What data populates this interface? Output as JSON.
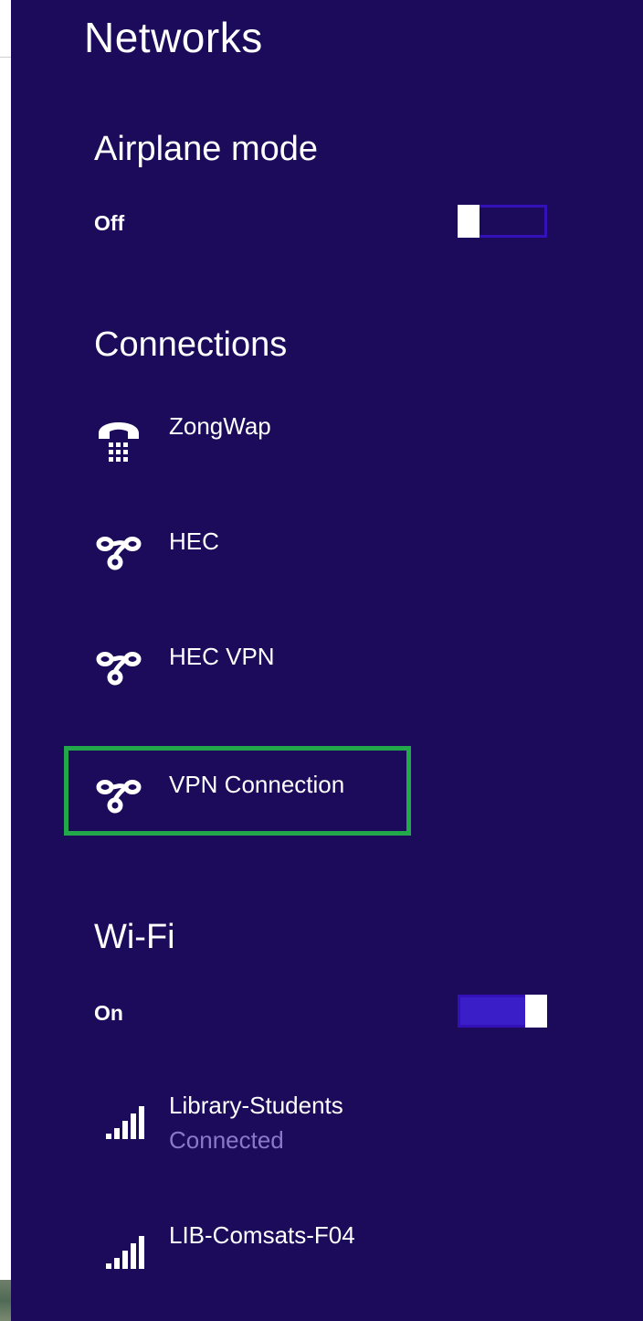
{
  "panel": {
    "title": "Networks",
    "background": "#1c0a5a"
  },
  "airplane_mode": {
    "heading": "Airplane mode",
    "state": "Off",
    "toggle_on": false
  },
  "connections": {
    "heading": "Connections",
    "items": [
      {
        "label": "ZongWap",
        "icon": "dialup-phone-icon"
      },
      {
        "label": "HEC",
        "icon": "vpn-link-icon"
      },
      {
        "label": "HEC VPN",
        "icon": "vpn-link-icon"
      },
      {
        "label": "VPN Connection",
        "icon": "vpn-link-icon",
        "highlighted": true
      }
    ]
  },
  "wifi": {
    "heading": "Wi-Fi",
    "state": "On",
    "toggle_on": true,
    "networks": [
      {
        "name": "Library-Students",
        "status": "Connected",
        "icon": "wifi-signal-icon"
      },
      {
        "name": "LIB-Comsats-F04",
        "icon": "wifi-signal-icon"
      }
    ]
  },
  "colors": {
    "highlight_border": "#22a84a",
    "toggle_track": "#3310b8",
    "toggle_fill": "#3a1fc8",
    "secondary_text": "#8a78c8"
  }
}
